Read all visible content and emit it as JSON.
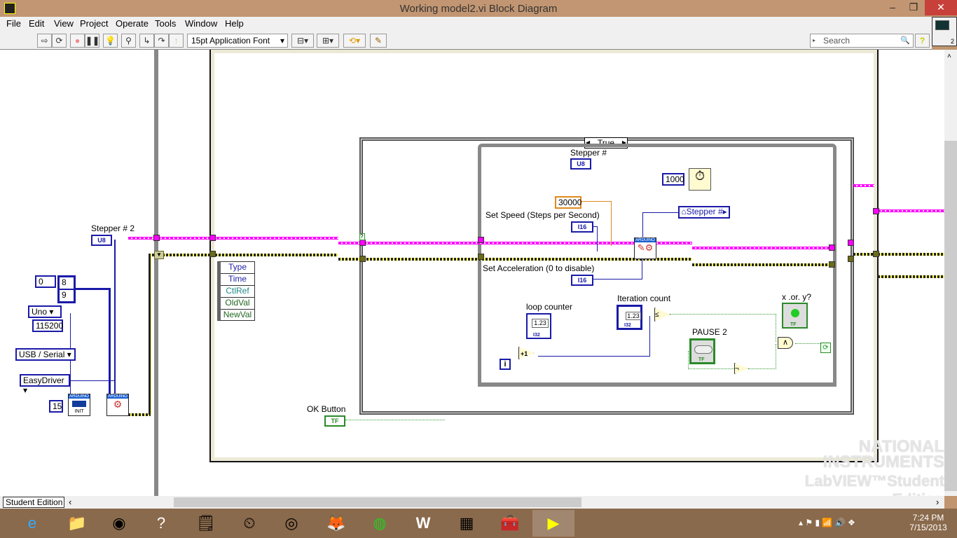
{
  "window": {
    "title": "Working model2.vi Block Diagram",
    "minimize": "‒",
    "restore": "❐",
    "close": "✕"
  },
  "menu": [
    "File",
    "Edit",
    "View",
    "Project",
    "Operate",
    "Tools",
    "Window",
    "Help"
  ],
  "toolbar": {
    "run": "⇨",
    "run_cont": "⟳",
    "abort": "●",
    "pause": "❚❚",
    "highlight": "💡",
    "retain": "⚲",
    "step_into": "↳",
    "step_over": "↷",
    "step_out": "↑",
    "font": "15pt Application Font",
    "font_arrow": "▾",
    "align": "⊟▾",
    "distribute": "⊞▾",
    "reorder": "⟲▾",
    "cleanup": "✎",
    "search_placeholder": "Search",
    "search_icon": "🔍",
    "help": "?"
  },
  "vi_icon": {
    "badge": "2"
  },
  "diagram": {
    "left": {
      "stepper2_label": "Stepper # 2",
      "stepper2_type": "U8",
      "array_index": "0",
      "array_values": [
        "8",
        "9"
      ],
      "board": "Uno",
      "baud": "115200",
      "connection": "USB / Serial",
      "driver": "EasyDriver",
      "pins": "15",
      "init_label": "INIT",
      "arduino_tag": "ARDUINO"
    },
    "event": {
      "fields": [
        "Type",
        "Time",
        "CtlRef",
        "OldVal",
        "NewVal"
      ],
      "ok_button_label": "OK Button",
      "ok_button_type": "TF"
    },
    "case": {
      "selector": "True",
      "unknown_tunnel": "?"
    },
    "inner": {
      "stepper_label": "Stepper #",
      "stepper_type": "U8",
      "wait_ms": "1000",
      "speed_const": "30000",
      "speed_label": "Set Speed (Steps per Second)",
      "speed_type": "I16",
      "accel_label": "Set Acceleration (0 to disable)",
      "accel_type": "I16",
      "stepper_local": "Stepper #",
      "loop_counter_label": "loop counter",
      "loop_counter_value": "1.23",
      "loop_counter_type": "I32",
      "iter_label": "Iteration count",
      "iter_value": "1.23",
      "iter_type": "I32",
      "pause_label": "PAUSE 2",
      "pause_type": "TF",
      "xor_label": "x .or. y?",
      "xor_type": "TF",
      "increment": "+1",
      "index": "i",
      "and_gate": "∧",
      "not_gate": "¬",
      "compare": "≤",
      "stop": "⟳"
    }
  },
  "watermark": {
    "line1": "NATIONAL",
    "line2": "INSTRUMENTS",
    "line3": "LabVIEW™Student Edition"
  },
  "status": {
    "edition": "Student Edition"
  },
  "taskbar": {
    "apps": [
      "ie",
      "file-explorer",
      "media",
      "help",
      "sticky-notes",
      "timer",
      "chrome",
      "firefox",
      "spotify",
      "word",
      "control-panel",
      "toolbox",
      "labview"
    ],
    "time": "7:24 PM",
    "date": "7/15/2013"
  }
}
